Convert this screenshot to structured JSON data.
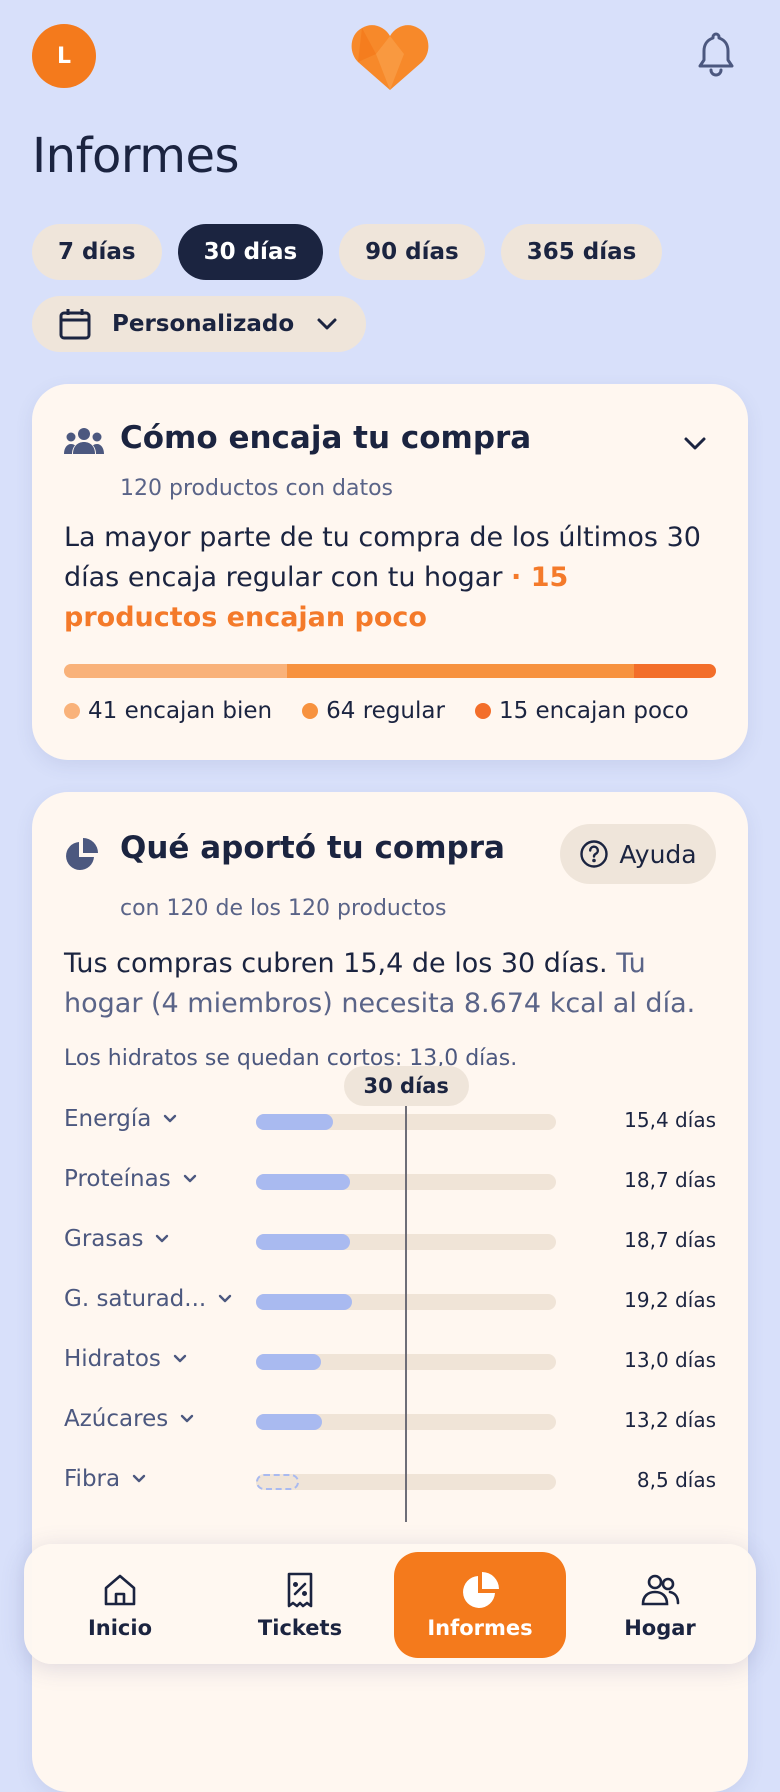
{
  "header": {
    "avatar_initial": "L",
    "page_title": "Informes"
  },
  "filters": {
    "chips": [
      "7 días",
      "30 días",
      "90 días",
      "365 días"
    ],
    "active_chip": "30 días",
    "custom_label": "Personalizado"
  },
  "fit_card": {
    "title": "Cómo encaja tu compra",
    "subtitle": "120 productos con datos",
    "summary": "La mayor parte de tu compra de los últimos 30 días encaja regular con tu hogar",
    "highlight": "· 15 productos encajan poco",
    "segments": [
      {
        "label": "41 encajan bien",
        "count": 41,
        "color": "#f9b27a"
      },
      {
        "label": "64 regular",
        "count": 64,
        "color": "#f7923f"
      },
      {
        "label": "15 encajan poco",
        "count": 15,
        "color": "#f36e2a"
      }
    ]
  },
  "contrib_card": {
    "title": "Qué aportó tu compra",
    "help_label": "Ayuda",
    "subtitle": "con 120 de los 120 productos",
    "summary_main": "Tus compras cubren 15,4 de los 30 días.",
    "summary_secondary": "Tu hogar (4 miembros) necesita 8.674 kcal al día.",
    "note": "Los hidratos se quedan cortos: 13,0 días.",
    "target_label": "30 días",
    "target_days": 30,
    "nutrients": [
      {
        "label": "Energía",
        "days": 15.4,
        "value": "15,4 días",
        "dashed": false
      },
      {
        "label": "Proteínas",
        "days": 18.7,
        "value": "18,7 días",
        "dashed": false
      },
      {
        "label": "Grasas",
        "days": 18.7,
        "value": "18,7 días",
        "dashed": false
      },
      {
        "label": "G. saturad...",
        "days": 19.2,
        "value": "19,2 días",
        "dashed": false
      },
      {
        "label": "Hidratos",
        "days": 13.0,
        "value": "13,0 días",
        "dashed": false
      },
      {
        "label": "Azúcares",
        "days": 13.2,
        "value": "13,2 días",
        "dashed": false
      },
      {
        "label": "Fibra",
        "days": 8.5,
        "value": "8,5 días",
        "dashed": true
      }
    ]
  },
  "nav": {
    "items": [
      {
        "label": "Inicio",
        "icon": "home-icon"
      },
      {
        "label": "Tickets",
        "icon": "receipt-icon"
      },
      {
        "label": "Informes",
        "icon": "pie-chart-icon"
      },
      {
        "label": "Hogar",
        "icon": "people-icon"
      }
    ],
    "active": "Informes"
  },
  "colors": {
    "background": "#d8e0fa",
    "accent": "#f47a1c",
    "dark": "#1b2440",
    "card": "#fff7f0",
    "bar_fill": "#a9baf0"
  }
}
